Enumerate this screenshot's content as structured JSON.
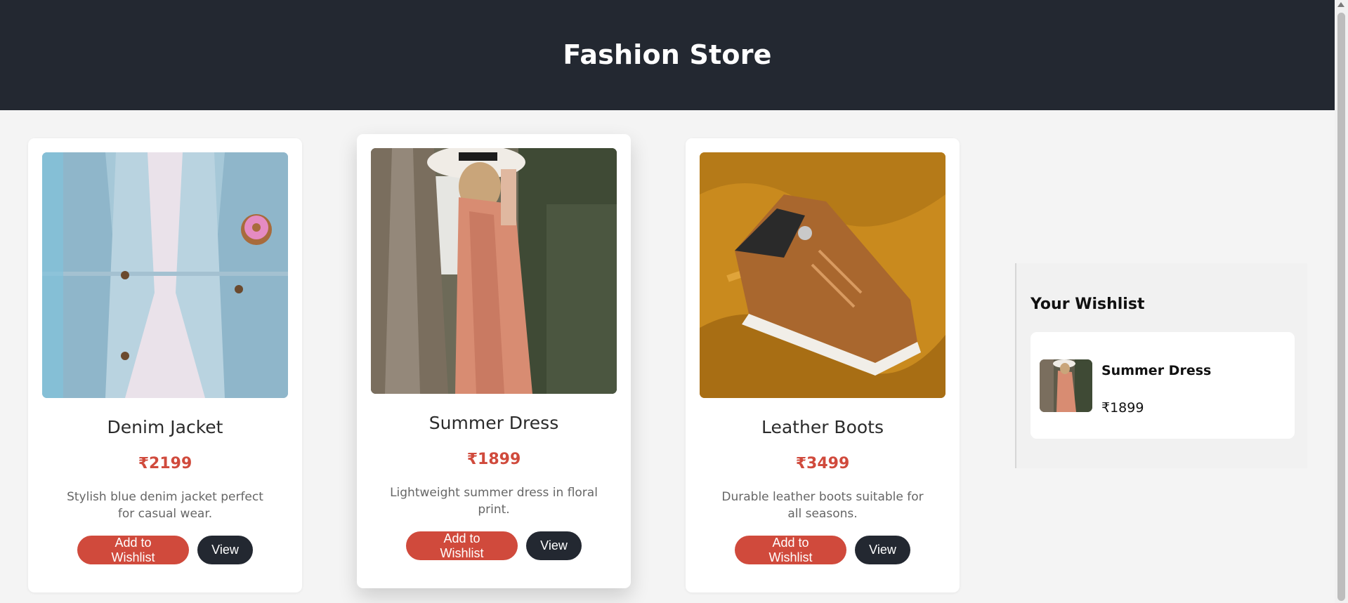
{
  "header": {
    "title": "Fashion Store"
  },
  "products": [
    {
      "name": "Denim Jacket",
      "price": "₹2199",
      "description": "Stylish blue denim jacket perfect for casual wear.",
      "wishlist_label": "Add to Wishlist",
      "view_label": "View"
    },
    {
      "name": "Summer Dress",
      "price": "₹1899",
      "description": "Lightweight summer dress in floral print.",
      "wishlist_label": "Add to Wishlist",
      "view_label": "View"
    },
    {
      "name": "Leather Boots",
      "price": "₹3499",
      "description": "Durable leather boots suitable for all seasons.",
      "wishlist_label": "Add to Wishlist",
      "view_label": "View"
    }
  ],
  "wishlist": {
    "title": "Your Wishlist",
    "items": [
      {
        "name": "Summer Dress",
        "price": "₹1899"
      }
    ]
  },
  "colors": {
    "header_bg": "#232831",
    "accent": "#d04a3c",
    "dark_button": "#232831",
    "page_bg": "#f4f4f4"
  }
}
